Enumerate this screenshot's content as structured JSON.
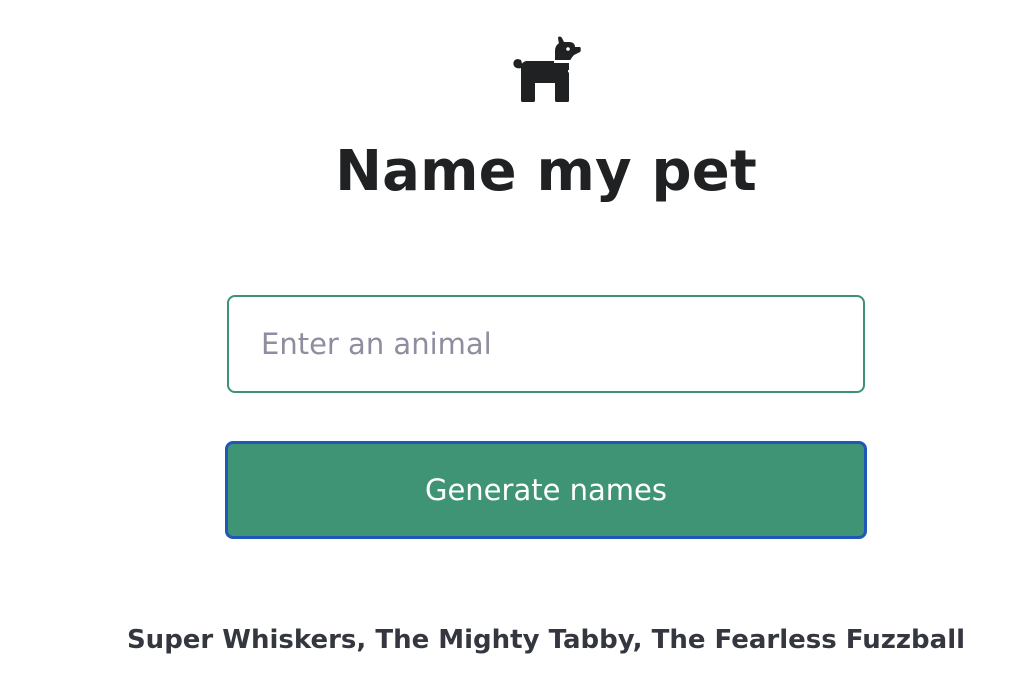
{
  "header": {
    "logo_icon": "dog-icon",
    "title": "Name my pet"
  },
  "form": {
    "animal_placeholder": "Enter an animal",
    "animal_value": "",
    "submit_label": "Generate names"
  },
  "result": {
    "text": "Super Whiskers, The Mighty Tabby, The Fearless Fuzzball"
  },
  "colors": {
    "accent": "#3e9474",
    "input_border": "#3b9277",
    "focus_ring": "#1f58b6",
    "text": "#202123"
  }
}
